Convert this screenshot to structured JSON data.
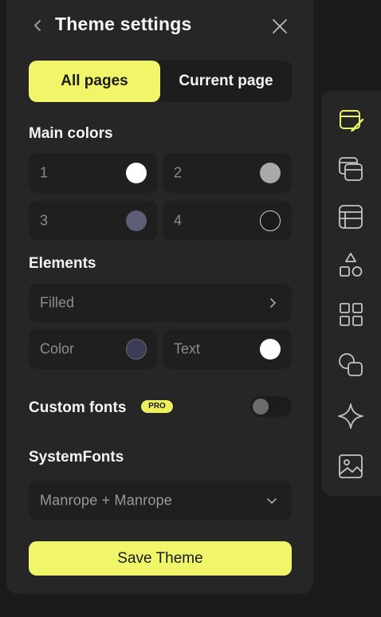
{
  "header": {
    "title": "Theme settings",
    "back_icon": "chevron-left-icon",
    "close_icon": "close-icon"
  },
  "scope": {
    "options": [
      "All pages",
      "Current page"
    ],
    "selected": "All pages"
  },
  "main_colors": {
    "title": "Main colors",
    "items": [
      {
        "label": "1",
        "color": "#ffffff"
      },
      {
        "label": "2",
        "color": "#a9a9ab"
      },
      {
        "label": "3",
        "color": "#5f5e79"
      },
      {
        "label": "4",
        "color": "#1a1a1a"
      }
    ]
  },
  "elements": {
    "title": "Elements",
    "filled": {
      "label": "Filled"
    },
    "color": {
      "label": "Color",
      "color": "#3b3d57"
    },
    "text": {
      "label": "Text",
      "color": "#ffffff"
    }
  },
  "custom_fonts": {
    "label": "Custom fonts",
    "badge": "PRO",
    "enabled": false
  },
  "system_fonts": {
    "title": "SystemFonts",
    "selected": "Manrope + Manrope"
  },
  "save_button": {
    "label": "Save Theme"
  },
  "colors": {
    "accent": "#f1f56a",
    "panel": "#262627",
    "field": "#1f1f20",
    "background": "#1b1b1c"
  },
  "rail": {
    "items": [
      {
        "icon": "theme-brush-icon",
        "active": true
      },
      {
        "icon": "pages-icon",
        "active": false
      },
      {
        "icon": "layout-icon",
        "active": false
      },
      {
        "icon": "shapes-icon",
        "active": false
      },
      {
        "icon": "grid-icon",
        "active": false
      },
      {
        "icon": "overlap-icon",
        "active": false
      },
      {
        "icon": "sparkle-icon",
        "active": false
      },
      {
        "icon": "image-icon",
        "active": false
      }
    ]
  }
}
